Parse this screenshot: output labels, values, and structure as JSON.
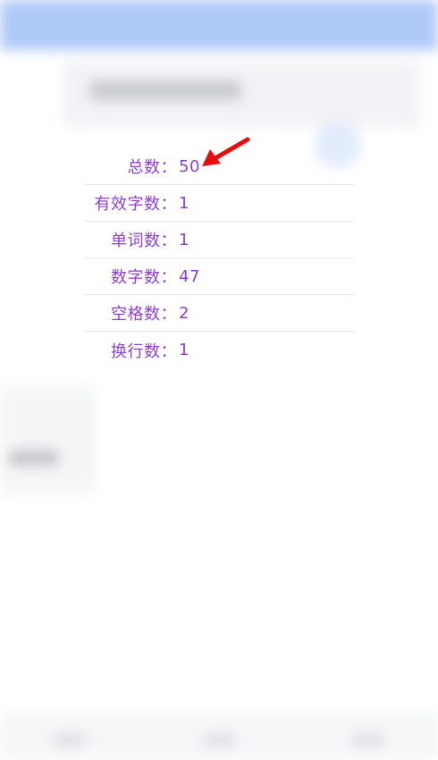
{
  "stats": {
    "rows": [
      {
        "label": "总数：",
        "value": "50"
      },
      {
        "label": "有效字数：",
        "value": "1"
      },
      {
        "label": "单词数：",
        "value": "1"
      },
      {
        "label": "数字数：",
        "value": "47"
      },
      {
        "label": "空格数：",
        "value": "2"
      },
      {
        "label": "换行数：",
        "value": "1"
      }
    ]
  },
  "colors": {
    "text": "#8f3fcf",
    "divider": "#e7e7e7",
    "arrow": "#e80d0d",
    "header_blurred": "#6d9cf3"
  },
  "annotation": {
    "icon": "red-arrow-pointer-icon"
  }
}
